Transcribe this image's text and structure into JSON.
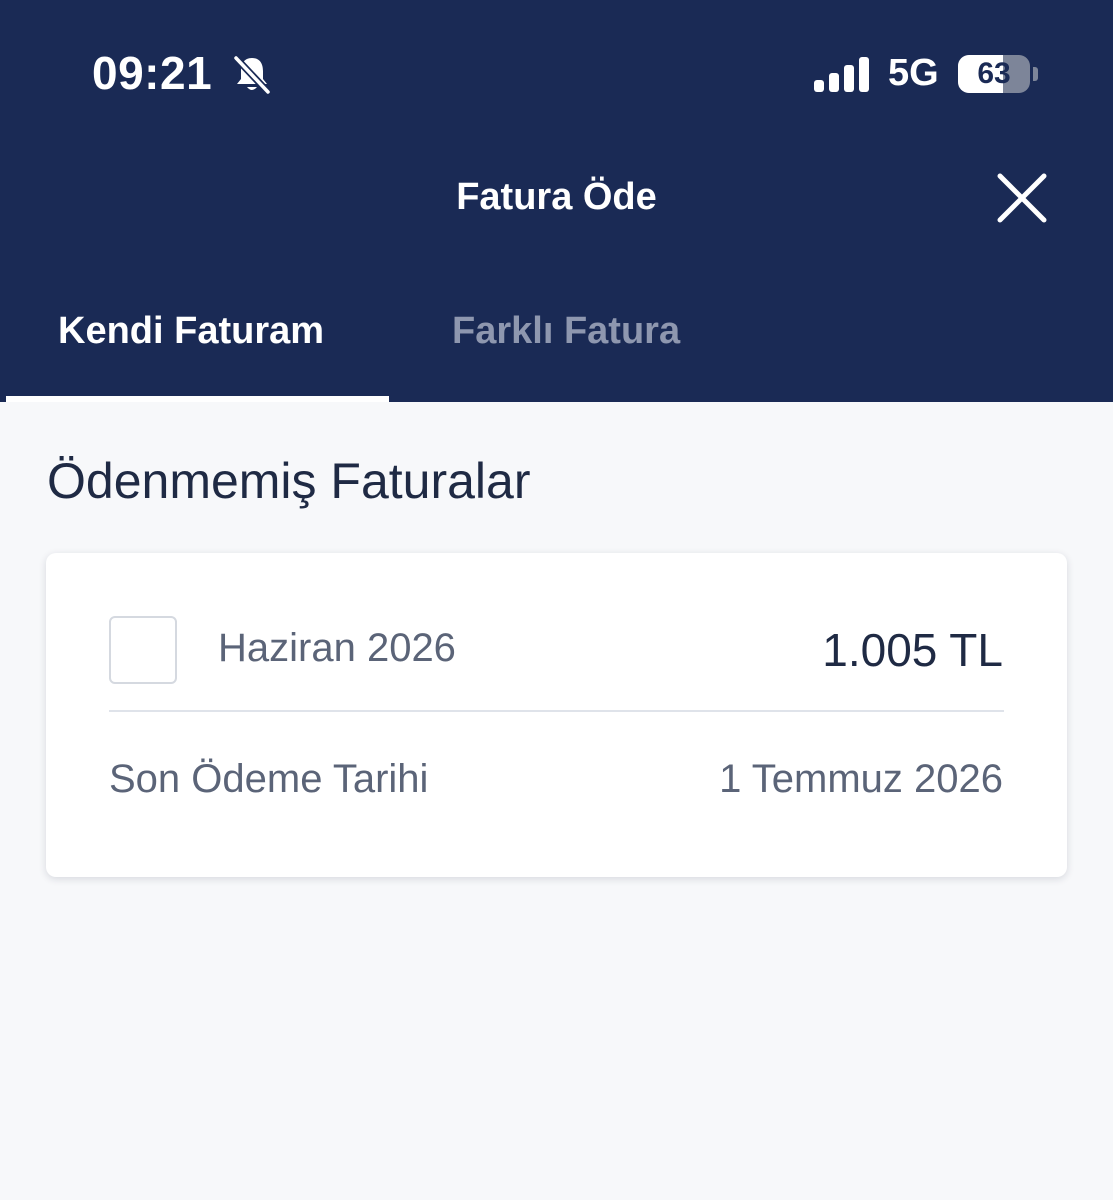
{
  "status_bar": {
    "time": "09:21",
    "network": "5G",
    "battery_level": 63,
    "battery_text": "63",
    "icons": {
      "silent": "bell-slash-icon",
      "signal": "cellular-signal-icon",
      "battery": "battery-icon"
    }
  },
  "header": {
    "title": "Fatura Öde",
    "close_icon": "close-icon"
  },
  "tabs": [
    {
      "label": "Kendi Faturam",
      "active": true
    },
    {
      "label": "Farklı Fatura",
      "active": false
    }
  ],
  "section": {
    "title": "Ödenmemiş Faturalar"
  },
  "bills": [
    {
      "period": "Haziran 2026",
      "amount": "1.005 TL",
      "checked": false,
      "due_label": "Son Ödeme Tarihi",
      "due_date": "1 Temmuz 2026"
    }
  ],
  "colors": {
    "header_bg": "#1a2a55",
    "page_bg": "#f7f8fa",
    "tab_active": "#ffffff",
    "tab_inactive": "#8e97af",
    "text_primary": "#1f2a44",
    "text_secondary": "#5b6478"
  }
}
